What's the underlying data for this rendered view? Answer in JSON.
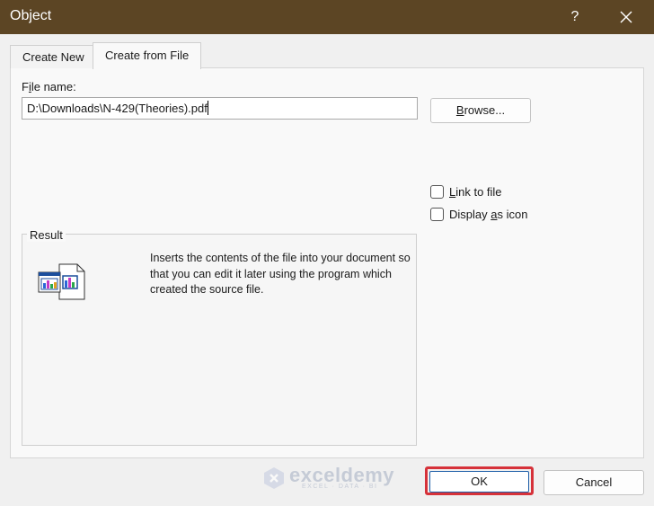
{
  "window": {
    "title": "Object",
    "help": "?",
    "colors": {
      "titlebar": "#5c4524",
      "ok_highlight": "#d6323a"
    }
  },
  "tabs": [
    {
      "label": "Create New",
      "active": false
    },
    {
      "label": "Create from File",
      "active": true
    }
  ],
  "file": {
    "label_prefix": "F",
    "label_mnemonic": "i",
    "label_suffix": "le name:",
    "value": "D:\\Downloads\\N-429(Theories).pdf",
    "browse_mnemonic": "B",
    "browse_rest": "rowse..."
  },
  "options": {
    "link": {
      "mnemonic": "L",
      "rest": "ink to file",
      "checked": false
    },
    "display": {
      "before": "Display ",
      "mnemonic": "a",
      "after": "s icon",
      "checked": false
    }
  },
  "result": {
    "legend": "Result",
    "icon": "embedded-document-icon",
    "description": "Inserts the contents of the file into your document so that you can edit it later using the program which created the source file."
  },
  "watermark": {
    "name": "exceldemy",
    "tagline": "EXCEL · DATA · BI"
  },
  "buttons": {
    "ok": "OK",
    "cancel": "Cancel"
  }
}
